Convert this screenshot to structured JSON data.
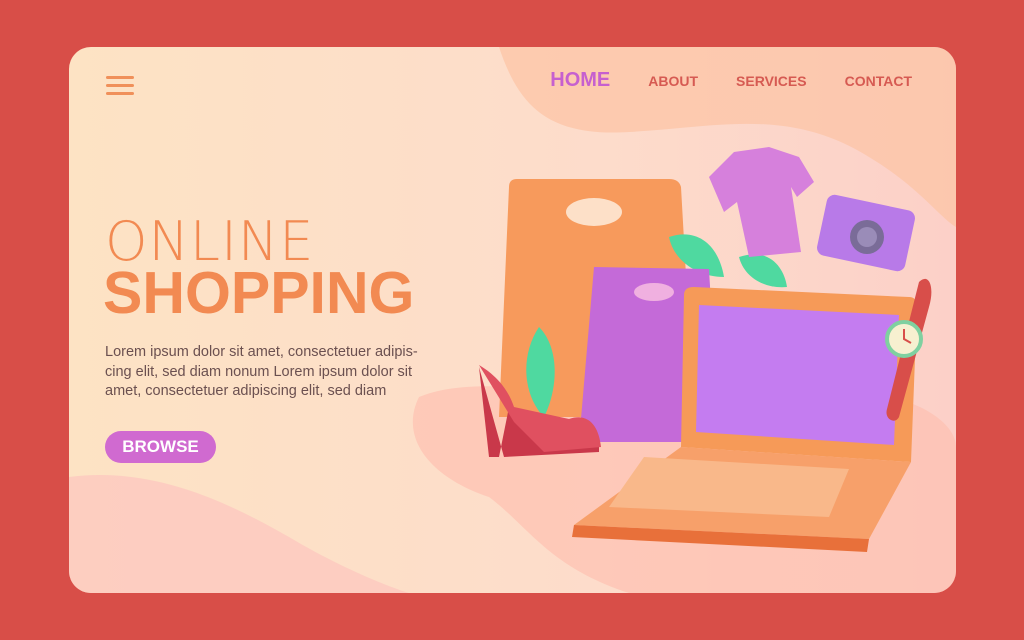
{
  "nav": {
    "items": [
      {
        "label": "HOME",
        "active": true
      },
      {
        "label": "ABOUT"
      },
      {
        "label": "SERVICES"
      },
      {
        "label": "CONTACT"
      }
    ]
  },
  "menu_icon": "hamburger-menu-icon",
  "hero": {
    "title_line1": "ONLINE",
    "title_line2": "SHOPPING",
    "description": "Lorem ipsum dolor sit amet, consectetuer adipis-cing elit, sed diam nonum Lorem ipsum dolor sit amet, consectetuer adipiscing elit, sed diam",
    "button_label": "BROWSE"
  },
  "colors": {
    "frame": "#d84e48",
    "accent_orange": "#f28a52",
    "accent_purple": "#d06ad0",
    "nav_text": "#d65a52"
  },
  "illustration": [
    "shopping-bag-orange",
    "shopping-bag-purple",
    "t-shirt",
    "camera",
    "laptop",
    "wristwatch",
    "high-heel-shoe",
    "plant-leaves"
  ]
}
